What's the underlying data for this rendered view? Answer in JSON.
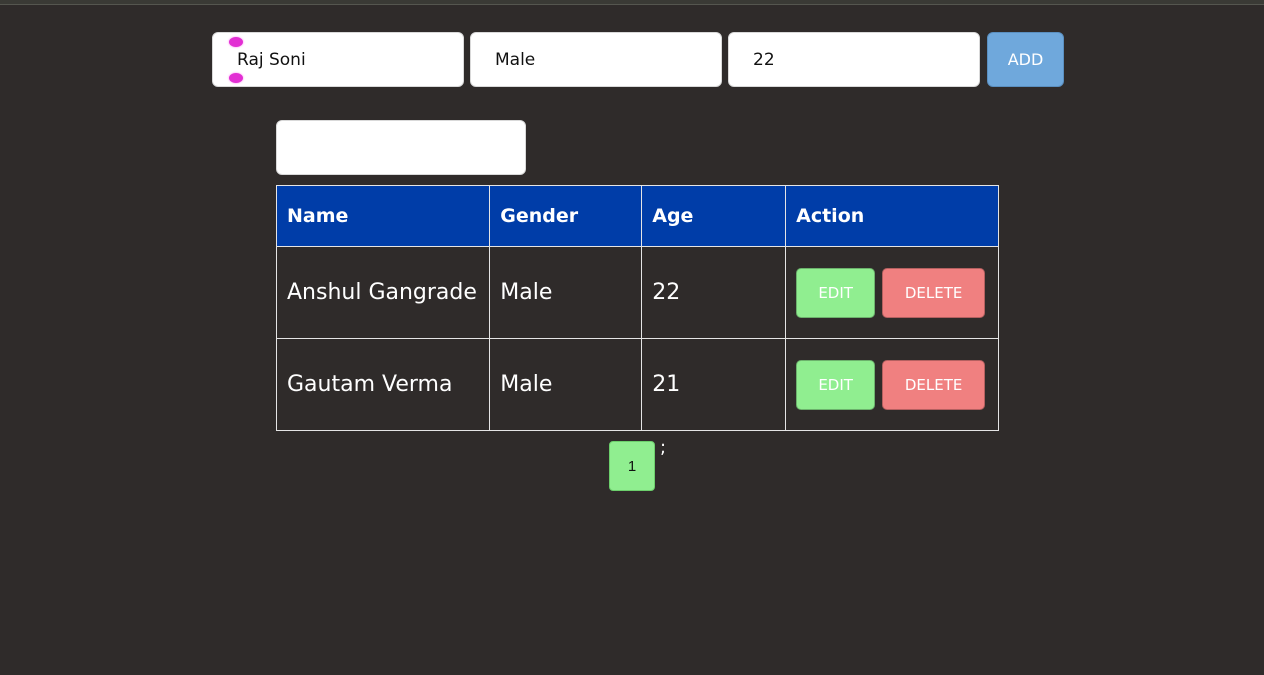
{
  "form": {
    "name_value": "Raj Soni",
    "gender_value": "Male",
    "age_value": "22",
    "add_label": "ADD"
  },
  "search": {
    "value": ""
  },
  "table": {
    "headers": [
      "Name",
      "Gender",
      "Age",
      "Action"
    ],
    "rows": [
      {
        "name": "Anshul Gangrade",
        "gender": "Male",
        "age": "22",
        "edit_label": "EDIT",
        "delete_label": "DELETE"
      },
      {
        "name": "Gautam Verma",
        "gender": "Male",
        "age": "21",
        "edit_label": "EDIT",
        "delete_label": "DELETE"
      }
    ]
  },
  "pagination": {
    "current_page": "1",
    "trailing_text": ";"
  },
  "colors": {
    "background": "#2f2b2a",
    "header": "#003da8",
    "add_button": "#6fa8dc",
    "edit_button": "#90ee90",
    "delete_button": "#f08080",
    "page_button": "#90ee90"
  },
  "icons": {
    "text_cursor": "text-cursor-icon"
  }
}
